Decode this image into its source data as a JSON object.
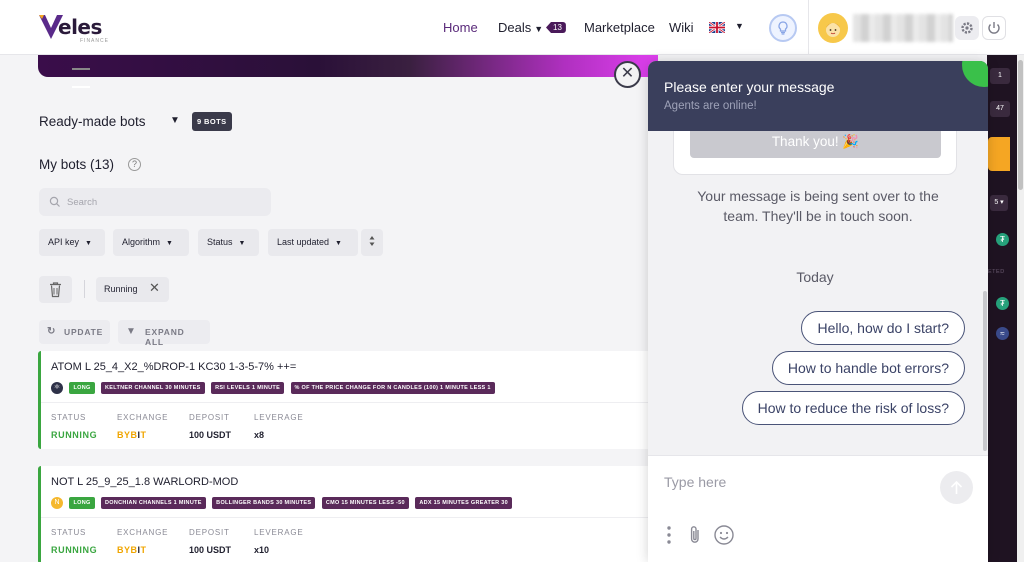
{
  "header": {
    "logo_text": "eles",
    "logo_sub": "FINANCE",
    "nav": {
      "home": "Home",
      "deals": "Deals",
      "deals_count": "13",
      "marketplace": "Marketplace",
      "wiki": "Wiki"
    }
  },
  "main": {
    "ready_made_title": "Ready-made bots",
    "ready_made_badge": "9 BOTS",
    "my_bots_title": "My bots (13)",
    "search_placeholder": "Search",
    "filters": {
      "api_key": "API key",
      "algorithm": "Algorithm",
      "status": "Status",
      "last_updated": "Last updated"
    },
    "active_chip": "Running",
    "actions": {
      "update": "UPDATE",
      "expand_all": "EXPAND ALL"
    },
    "stat_labels": {
      "status": "STATUS",
      "exchange": "EXCHANGE",
      "deposit": "DEPOSIT",
      "leverage": "LEVERAGE"
    },
    "bots": [
      {
        "name": "ATOM L 25_4_X2_%DROP-1 KC30 1-3-5-7% ++=",
        "coin": "A",
        "coin_color": "#2e3148",
        "direction": "LONG",
        "indicators": [
          "KELTNER CHANNEL 30 MINUTES",
          "RSI LEVELS 1 MINUTE",
          "% OF THE PRICE CHANGE FOR N CANDLES (100) 1 MINUTE LESS 1"
        ],
        "status": "RUNNING",
        "exchange": "BYBIT",
        "deposit": "100 USDT",
        "leverage": "x8"
      },
      {
        "name": "NOT L 25_9_25_1.8 WARLORD-MOD",
        "coin": "N",
        "coin_color": "#f5b82e",
        "direction": "LONG",
        "indicators": [
          "DONCHIAN CHANNELS 1 MINUTE",
          "BOLLINGER BANDS 30 MINUTES",
          "CMO 15 MINUTES LESS -50",
          "ADX 15 MINUTES GREATER 30"
        ],
        "status": "RUNNING",
        "exchange": "BYBIT",
        "deposit": "100 USDT",
        "leverage": "x10"
      }
    ]
  },
  "right_panel": {
    "badge_1": "1",
    "badge_2": "47",
    "partial_number": "5",
    "partial_text": "ETED"
  },
  "chat": {
    "title": "Please enter your message",
    "subtitle": "Agents are online!",
    "thank_button": "Thank you! 🎉",
    "sent_message": "Your message is being sent over to the team. They'll be in touch soon.",
    "day_label": "Today",
    "quick_replies": [
      "Hello, how do I start?",
      "How to handle bot errors?",
      "How to reduce the risk of loss?"
    ],
    "input_placeholder": "Type here"
  },
  "colors": {
    "brand": "#4a1a5a",
    "running": "#3aa640",
    "chat_header": "#3a3f5c",
    "bybit": "#f0a500"
  }
}
